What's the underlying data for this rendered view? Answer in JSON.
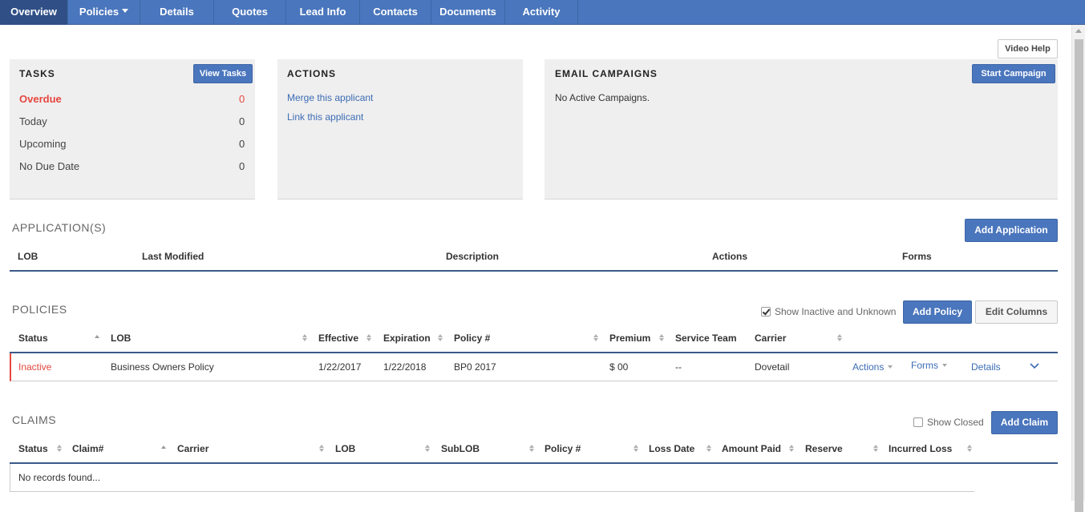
{
  "nav": {
    "tabs": [
      {
        "label": "Overview"
      },
      {
        "label": "Policies"
      },
      {
        "label": "Details"
      },
      {
        "label": "Quotes"
      },
      {
        "label": "Lead Info"
      },
      {
        "label": "Contacts"
      },
      {
        "label": "Documents"
      },
      {
        "label": "Activity"
      }
    ]
  },
  "video_help": "Video Help",
  "tasks": {
    "title": "TASKS",
    "button": "View Tasks",
    "rows": [
      {
        "label": "Overdue",
        "count": "0"
      },
      {
        "label": "Today",
        "count": "0"
      },
      {
        "label": "Upcoming",
        "count": "0"
      },
      {
        "label": "No Due Date",
        "count": "0"
      }
    ]
  },
  "actions": {
    "title": "ACTIONS",
    "links": [
      "Merge this applicant",
      "Link this applicant"
    ]
  },
  "email": {
    "title": "EMAIL CAMPAIGNS",
    "button": "Start Campaign",
    "text": "No Active Campaigns."
  },
  "applications": {
    "title": "APPLICATION(S)",
    "button": "Add Application",
    "columns": [
      "LOB",
      "Last Modified",
      "Description",
      "Actions",
      "Forms"
    ]
  },
  "policies": {
    "title": "POLICIES",
    "show_inactive_label": "Show Inactive and Unknown",
    "show_inactive_checked": true,
    "add_button": "Add Policy",
    "edit_columns_button": "Edit Columns",
    "columns": [
      "Status",
      "LOB",
      "Effective",
      "Expiration",
      "Policy #",
      "Premium",
      "Service Team",
      "Carrier"
    ],
    "rows": [
      {
        "status": "Inactive",
        "lob": "Business Owners Policy",
        "effective": "1/22/2017",
        "expiration": "1/22/2018",
        "policy_number": "BP0  2017",
        "premium": "$  00",
        "service_team": "--",
        "carrier": "Dovetail",
        "actions": "Actions",
        "forms": "Forms",
        "details": "Details"
      }
    ]
  },
  "claims": {
    "title": "CLAIMS",
    "show_closed_label": "Show Closed",
    "show_closed_checked": false,
    "add_button": "Add Claim",
    "columns": [
      "Status",
      "Claim#",
      "Carrier",
      "LOB",
      "SubLOB",
      "Policy #",
      "Loss Date",
      "Amount Paid",
      "Reserve",
      "Incurred Loss"
    ],
    "empty_text": "No records found..."
  },
  "colors": {
    "nav_bg": "#4a76bd",
    "nav_active": "#2f4f86",
    "button_blue": "#4a76bd",
    "overdue_red": "#e5473f",
    "link_blue": "#3c6cb5"
  }
}
